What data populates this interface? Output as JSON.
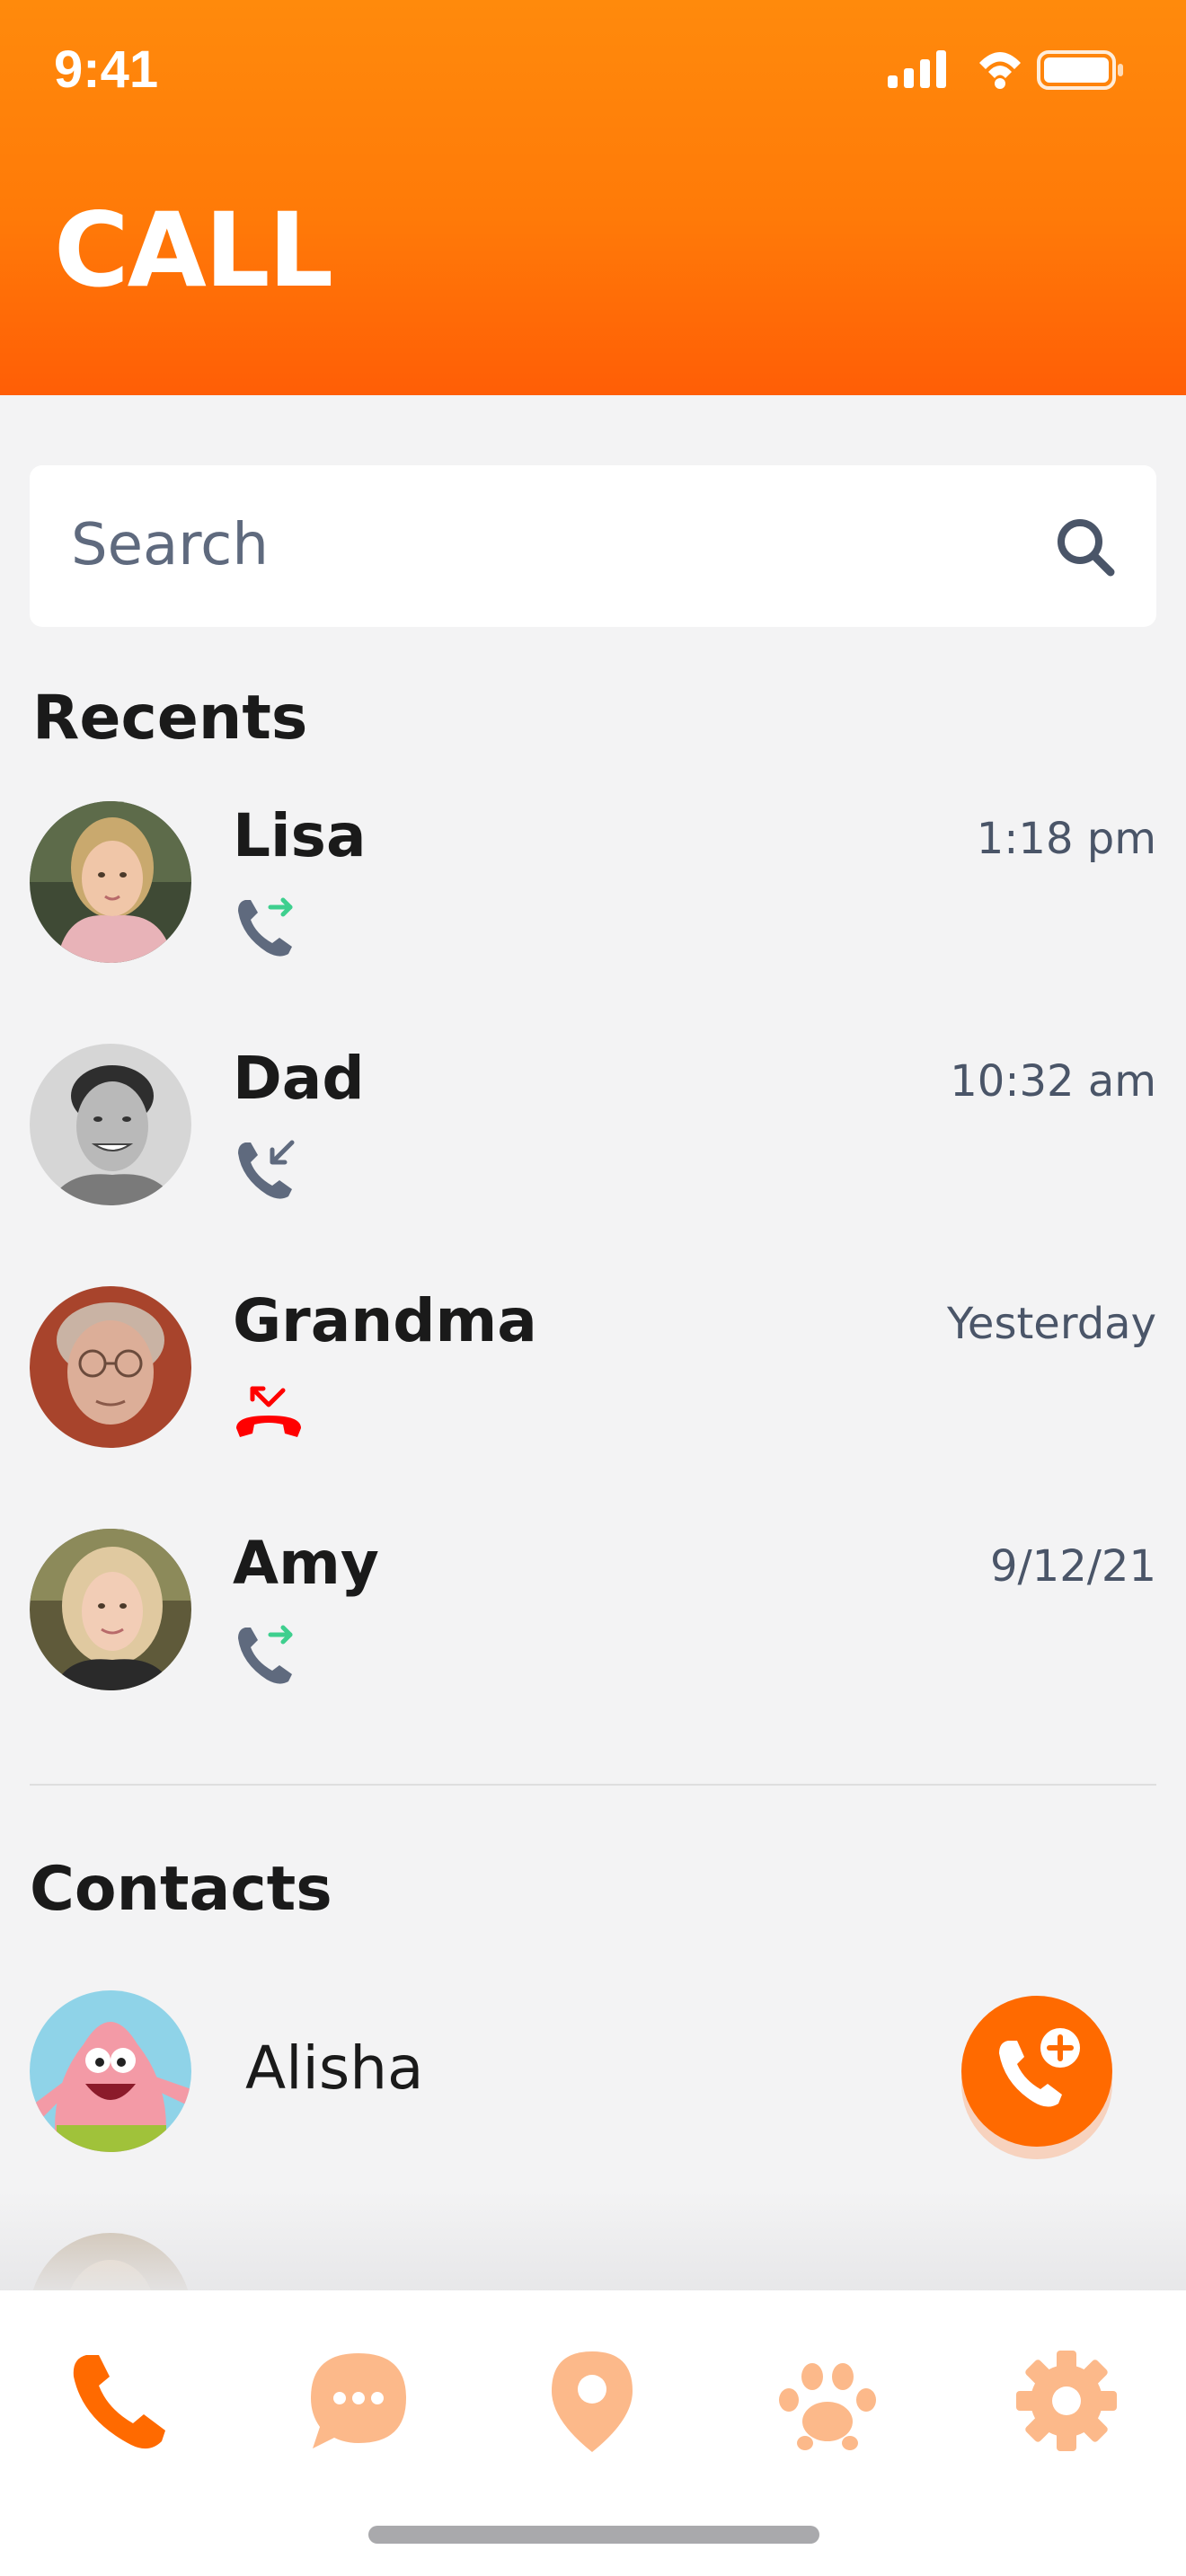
{
  "status_bar": {
    "time": "9:41"
  },
  "header": {
    "title": "CALL"
  },
  "search": {
    "placeholder": "Search"
  },
  "recents": {
    "heading": "Recents",
    "items": [
      {
        "name": "Lisa",
        "time": "1:18 pm",
        "call_type": "outgoing"
      },
      {
        "name": "Dad",
        "time": "10:32 am",
        "call_type": "incoming"
      },
      {
        "name": "Grandma",
        "time": "Yesterday",
        "call_type": "missed"
      },
      {
        "name": "Amy",
        "time": "9/12/21",
        "call_type": "outgoing"
      }
    ]
  },
  "contacts": {
    "heading": "Contacts",
    "items": [
      {
        "name": "Alisha"
      }
    ]
  },
  "colors": {
    "accent": "#ff6a00",
    "tab_inactive": "#fcb98a",
    "outgoing_arrow": "#3ecf8e",
    "missed": "#ff0000",
    "phone_gray": "#5f6a7e"
  },
  "tabs": [
    {
      "icon": "phone-icon",
      "active": true
    },
    {
      "icon": "chat-icon",
      "active": false
    },
    {
      "icon": "location-pin-icon",
      "active": false
    },
    {
      "icon": "paw-icon",
      "active": false
    },
    {
      "icon": "gear-icon",
      "active": false
    }
  ]
}
